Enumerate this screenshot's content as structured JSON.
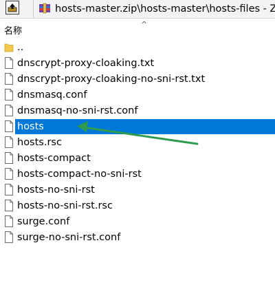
{
  "toolbar": {
    "up_icon": "folder-up-icon",
    "archive_icon": "winrar-archive-icon",
    "path": "hosts-master.zip\\hosts-master\\hosts-files - ZIP"
  },
  "header": {
    "name_column": "名称",
    "sort_indicator": "^"
  },
  "files": [
    {
      "name": "..",
      "type": "folder"
    },
    {
      "name": "dnscrypt-proxy-cloaking.txt",
      "type": "file"
    },
    {
      "name": "dnscrypt-proxy-cloaking-no-sni-rst.txt",
      "type": "file"
    },
    {
      "name": "dnsmasq.conf",
      "type": "file"
    },
    {
      "name": "dnsmasq-no-sni-rst.conf",
      "type": "file"
    },
    {
      "name": "hosts",
      "type": "file",
      "selected": true
    },
    {
      "name": "hosts.rsc",
      "type": "file"
    },
    {
      "name": "hosts-compact",
      "type": "file"
    },
    {
      "name": "hosts-compact-no-sni-rst",
      "type": "file"
    },
    {
      "name": "hosts-no-sni-rst",
      "type": "file"
    },
    {
      "name": "hosts-no-sni-rst.rsc",
      "type": "file"
    },
    {
      "name": "surge.conf",
      "type": "file"
    },
    {
      "name": "surge-no-sni-rst.conf",
      "type": "file"
    }
  ],
  "colors": {
    "selection": "#0078d7",
    "annotation_arrow": "#2e9b4f",
    "folder": "#f2c94c"
  }
}
